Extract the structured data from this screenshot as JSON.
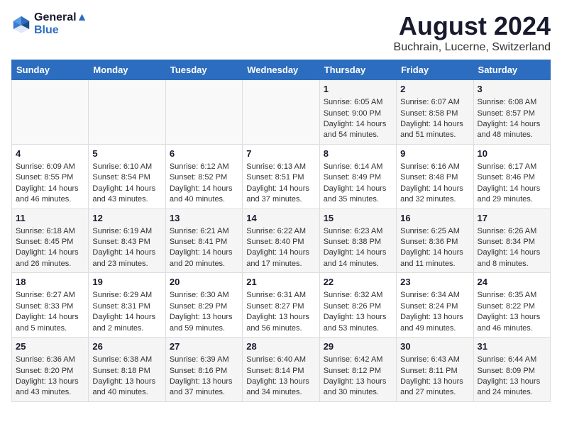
{
  "logo": {
    "line1": "General",
    "line2": "Blue"
  },
  "title": "August 2024",
  "location": "Buchrain, Lucerne, Switzerland",
  "days_of_week": [
    "Sunday",
    "Monday",
    "Tuesday",
    "Wednesday",
    "Thursday",
    "Friday",
    "Saturday"
  ],
  "weeks": [
    [
      {
        "day": "",
        "content": ""
      },
      {
        "day": "",
        "content": ""
      },
      {
        "day": "",
        "content": ""
      },
      {
        "day": "",
        "content": ""
      },
      {
        "day": "1",
        "content": "Sunrise: 6:05 AM\nSunset: 9:00 PM\nDaylight: 14 hours\nand 54 minutes."
      },
      {
        "day": "2",
        "content": "Sunrise: 6:07 AM\nSunset: 8:58 PM\nDaylight: 14 hours\nand 51 minutes."
      },
      {
        "day": "3",
        "content": "Sunrise: 6:08 AM\nSunset: 8:57 PM\nDaylight: 14 hours\nand 48 minutes."
      }
    ],
    [
      {
        "day": "4",
        "content": "Sunrise: 6:09 AM\nSunset: 8:55 PM\nDaylight: 14 hours\nand 46 minutes."
      },
      {
        "day": "5",
        "content": "Sunrise: 6:10 AM\nSunset: 8:54 PM\nDaylight: 14 hours\nand 43 minutes."
      },
      {
        "day": "6",
        "content": "Sunrise: 6:12 AM\nSunset: 8:52 PM\nDaylight: 14 hours\nand 40 minutes."
      },
      {
        "day": "7",
        "content": "Sunrise: 6:13 AM\nSunset: 8:51 PM\nDaylight: 14 hours\nand 37 minutes."
      },
      {
        "day": "8",
        "content": "Sunrise: 6:14 AM\nSunset: 8:49 PM\nDaylight: 14 hours\nand 35 minutes."
      },
      {
        "day": "9",
        "content": "Sunrise: 6:16 AM\nSunset: 8:48 PM\nDaylight: 14 hours\nand 32 minutes."
      },
      {
        "day": "10",
        "content": "Sunrise: 6:17 AM\nSunset: 8:46 PM\nDaylight: 14 hours\nand 29 minutes."
      }
    ],
    [
      {
        "day": "11",
        "content": "Sunrise: 6:18 AM\nSunset: 8:45 PM\nDaylight: 14 hours\nand 26 minutes."
      },
      {
        "day": "12",
        "content": "Sunrise: 6:19 AM\nSunset: 8:43 PM\nDaylight: 14 hours\nand 23 minutes."
      },
      {
        "day": "13",
        "content": "Sunrise: 6:21 AM\nSunset: 8:41 PM\nDaylight: 14 hours\nand 20 minutes."
      },
      {
        "day": "14",
        "content": "Sunrise: 6:22 AM\nSunset: 8:40 PM\nDaylight: 14 hours\nand 17 minutes."
      },
      {
        "day": "15",
        "content": "Sunrise: 6:23 AM\nSunset: 8:38 PM\nDaylight: 14 hours\nand 14 minutes."
      },
      {
        "day": "16",
        "content": "Sunrise: 6:25 AM\nSunset: 8:36 PM\nDaylight: 14 hours\nand 11 minutes."
      },
      {
        "day": "17",
        "content": "Sunrise: 6:26 AM\nSunset: 8:34 PM\nDaylight: 14 hours\nand 8 minutes."
      }
    ],
    [
      {
        "day": "18",
        "content": "Sunrise: 6:27 AM\nSunset: 8:33 PM\nDaylight: 14 hours\nand 5 minutes."
      },
      {
        "day": "19",
        "content": "Sunrise: 6:29 AM\nSunset: 8:31 PM\nDaylight: 14 hours\nand 2 minutes."
      },
      {
        "day": "20",
        "content": "Sunrise: 6:30 AM\nSunset: 8:29 PM\nDaylight: 13 hours\nand 59 minutes."
      },
      {
        "day": "21",
        "content": "Sunrise: 6:31 AM\nSunset: 8:27 PM\nDaylight: 13 hours\nand 56 minutes."
      },
      {
        "day": "22",
        "content": "Sunrise: 6:32 AM\nSunset: 8:26 PM\nDaylight: 13 hours\nand 53 minutes."
      },
      {
        "day": "23",
        "content": "Sunrise: 6:34 AM\nSunset: 8:24 PM\nDaylight: 13 hours\nand 49 minutes."
      },
      {
        "day": "24",
        "content": "Sunrise: 6:35 AM\nSunset: 8:22 PM\nDaylight: 13 hours\nand 46 minutes."
      }
    ],
    [
      {
        "day": "25",
        "content": "Sunrise: 6:36 AM\nSunset: 8:20 PM\nDaylight: 13 hours\nand 43 minutes."
      },
      {
        "day": "26",
        "content": "Sunrise: 6:38 AM\nSunset: 8:18 PM\nDaylight: 13 hours\nand 40 minutes."
      },
      {
        "day": "27",
        "content": "Sunrise: 6:39 AM\nSunset: 8:16 PM\nDaylight: 13 hours\nand 37 minutes."
      },
      {
        "day": "28",
        "content": "Sunrise: 6:40 AM\nSunset: 8:14 PM\nDaylight: 13 hours\nand 34 minutes."
      },
      {
        "day": "29",
        "content": "Sunrise: 6:42 AM\nSunset: 8:12 PM\nDaylight: 13 hours\nand 30 minutes."
      },
      {
        "day": "30",
        "content": "Sunrise: 6:43 AM\nSunset: 8:11 PM\nDaylight: 13 hours\nand 27 minutes."
      },
      {
        "day": "31",
        "content": "Sunrise: 6:44 AM\nSunset: 8:09 PM\nDaylight: 13 hours\nand 24 minutes."
      }
    ]
  ]
}
